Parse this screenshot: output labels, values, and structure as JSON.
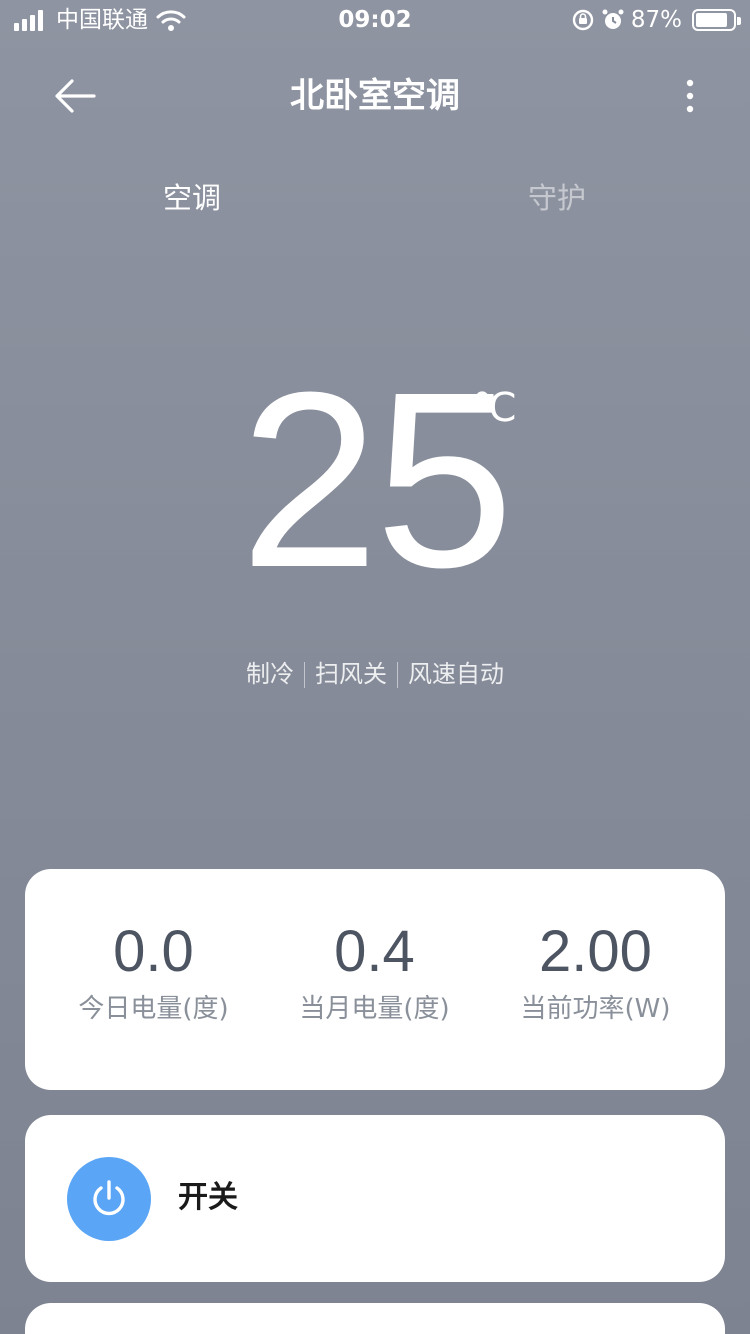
{
  "status_bar": {
    "carrier": "中国联通",
    "time": "09:02",
    "battery_percent": "87%",
    "battery_level": 0.87,
    "icons": [
      "signal-icon",
      "wifi-icon",
      "rotation-lock-icon",
      "alarm-icon",
      "battery-icon"
    ]
  },
  "nav": {
    "title": "北卧室空调",
    "back_icon": "arrow-left-icon",
    "more_icon": "more-vertical-icon"
  },
  "tabs": [
    {
      "label": "空调",
      "active": true
    },
    {
      "label": "守护",
      "active": false
    }
  ],
  "temperature": {
    "value": "25",
    "unit": "℃"
  },
  "modes": [
    "制冷",
    "扫风关",
    "风速自动"
  ],
  "stats": [
    {
      "value": "0.0",
      "label": "今日电量(度)"
    },
    {
      "value": "0.4",
      "label": "当月电量(度)"
    },
    {
      "value": "2.00",
      "label": "当前功率(W)"
    }
  ],
  "power": {
    "label": "开关",
    "icon": "power-icon",
    "accent_color": "#5aa5f5"
  },
  "colors": {
    "background": "#868c99",
    "card": "#ffffff",
    "stat_value": "#4d5563",
    "stat_label": "#8a909a"
  }
}
